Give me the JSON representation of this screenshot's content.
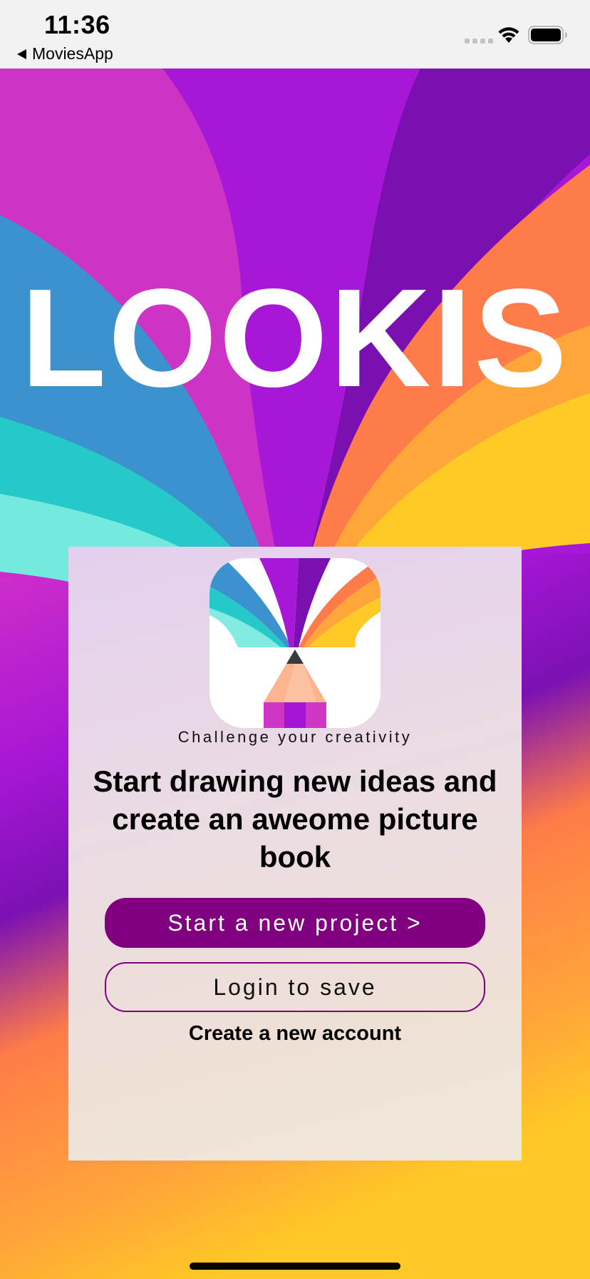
{
  "status_bar": {
    "time": "11:36",
    "back_label": "MoviesApp"
  },
  "hero": {
    "logo_text": "LOOKIS"
  },
  "card": {
    "tagline": "Challenge your creativity",
    "headline": "Start drawing new ideas and create an aweome picture book",
    "primary_button": "Start a new project >",
    "secondary_button": "Login to save",
    "create_account_link": "Create a new account"
  },
  "colors": {
    "accent": "#800080",
    "magenta": "#cf36c4",
    "violet": "#a515d6",
    "deep_purple": "#7a10b0",
    "orange": "#fe7c49",
    "yellow": "#ffc926",
    "blue": "#3a93cf",
    "teal": "#24c9c9",
    "mint": "#72eadf"
  },
  "icons": [
    "back-arrow-icon",
    "signal-icon",
    "wifi-icon",
    "battery-icon",
    "pencil-icon"
  ]
}
